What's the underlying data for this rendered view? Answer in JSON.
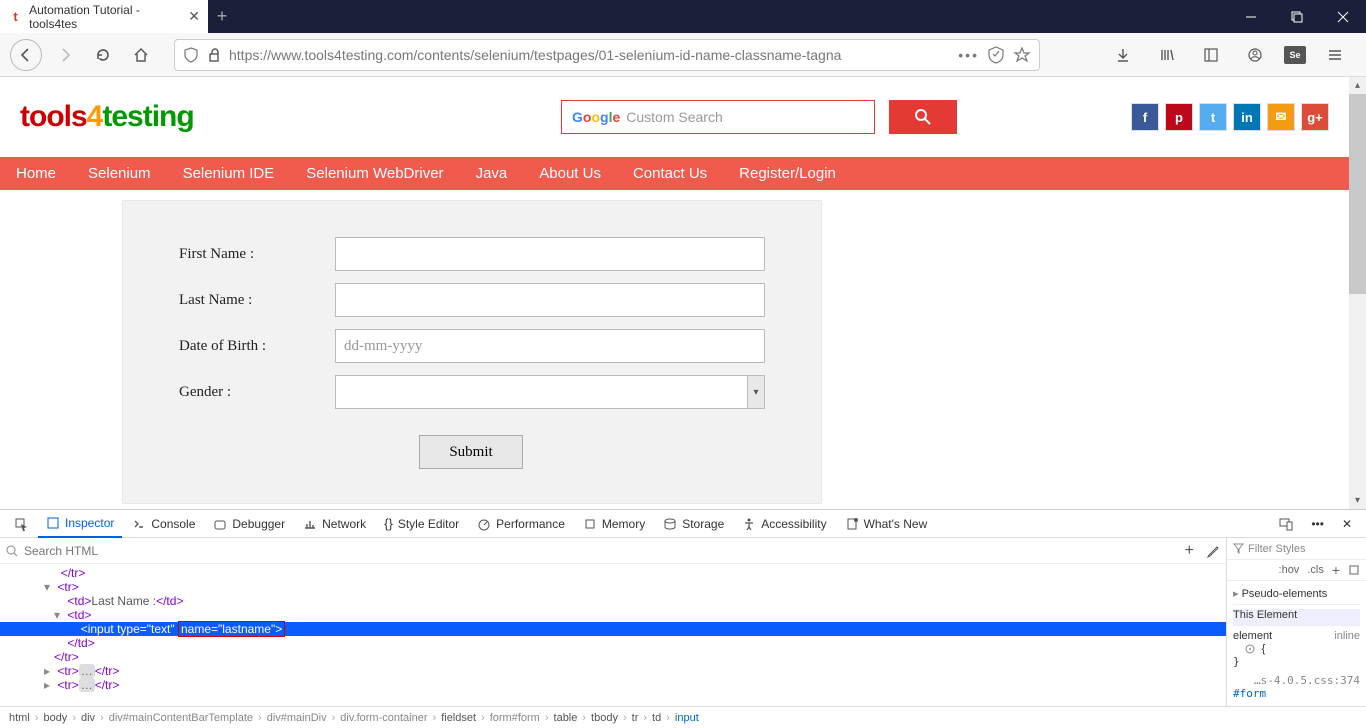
{
  "browser": {
    "tab_title": "Automation Tutorial - tools4tes",
    "url": "https://www.tools4testing.com/contents/selenium/testpages/01-selenium-id-name-classname-tagna"
  },
  "site": {
    "logo_parts": [
      "tools",
      "4",
      "testing"
    ],
    "search_placeholder": "Custom Search",
    "nav": [
      "Home",
      "Selenium",
      "Selenium IDE",
      "Selenium WebDriver",
      "Java",
      "About Us",
      "Contact Us",
      "Register/Login"
    ]
  },
  "form": {
    "first_name_label": "First Name :",
    "last_name_label": "Last Name :",
    "dob_label": "Date of Birth :",
    "dob_placeholder": "dd-mm-yyyy",
    "gender_label": "Gender :",
    "submit_label": "Submit"
  },
  "devtools": {
    "tabs": [
      "Inspector",
      "Console",
      "Debugger",
      "Network",
      "Style Editor",
      "Performance",
      "Memory",
      "Storage",
      "Accessibility",
      "What's New"
    ],
    "search_placeholder": "Search HTML",
    "tree": {
      "l0": "</tr>",
      "l1": "<tr>",
      "l2_open": "<td>",
      "l2_text": "Last Name :",
      "l2_close": "</td>",
      "l3": "<td>",
      "l4_full": "<input type=\"text\" name=\"lastname\">",
      "l4_boxed": "name=\"lastname\">",
      "l5": "</td>",
      "l6": "</tr>",
      "l7a": "<tr>",
      "l7b": "</tr>",
      "l8a": "<tr>",
      "l8b": "</tr>"
    },
    "styles": {
      "filter": "Filter Styles",
      "hov": ":hov",
      "cls": ".cls",
      "pseudo": "Pseudo-elements",
      "this_el": "This Element",
      "rule1a": "element",
      "rule1b": "inline",
      "brace": "{",
      "cbrace": "}",
      "footer": "…s-4.0.5.css:374",
      "footer2": "#form"
    },
    "breadcrumb": [
      "html",
      "body",
      "div",
      "div#mainContentBarTemplate",
      "div#mainDiv",
      "div.form-container",
      "fieldset",
      "form#form",
      "table",
      "tbody",
      "tr",
      "td",
      "input"
    ]
  }
}
